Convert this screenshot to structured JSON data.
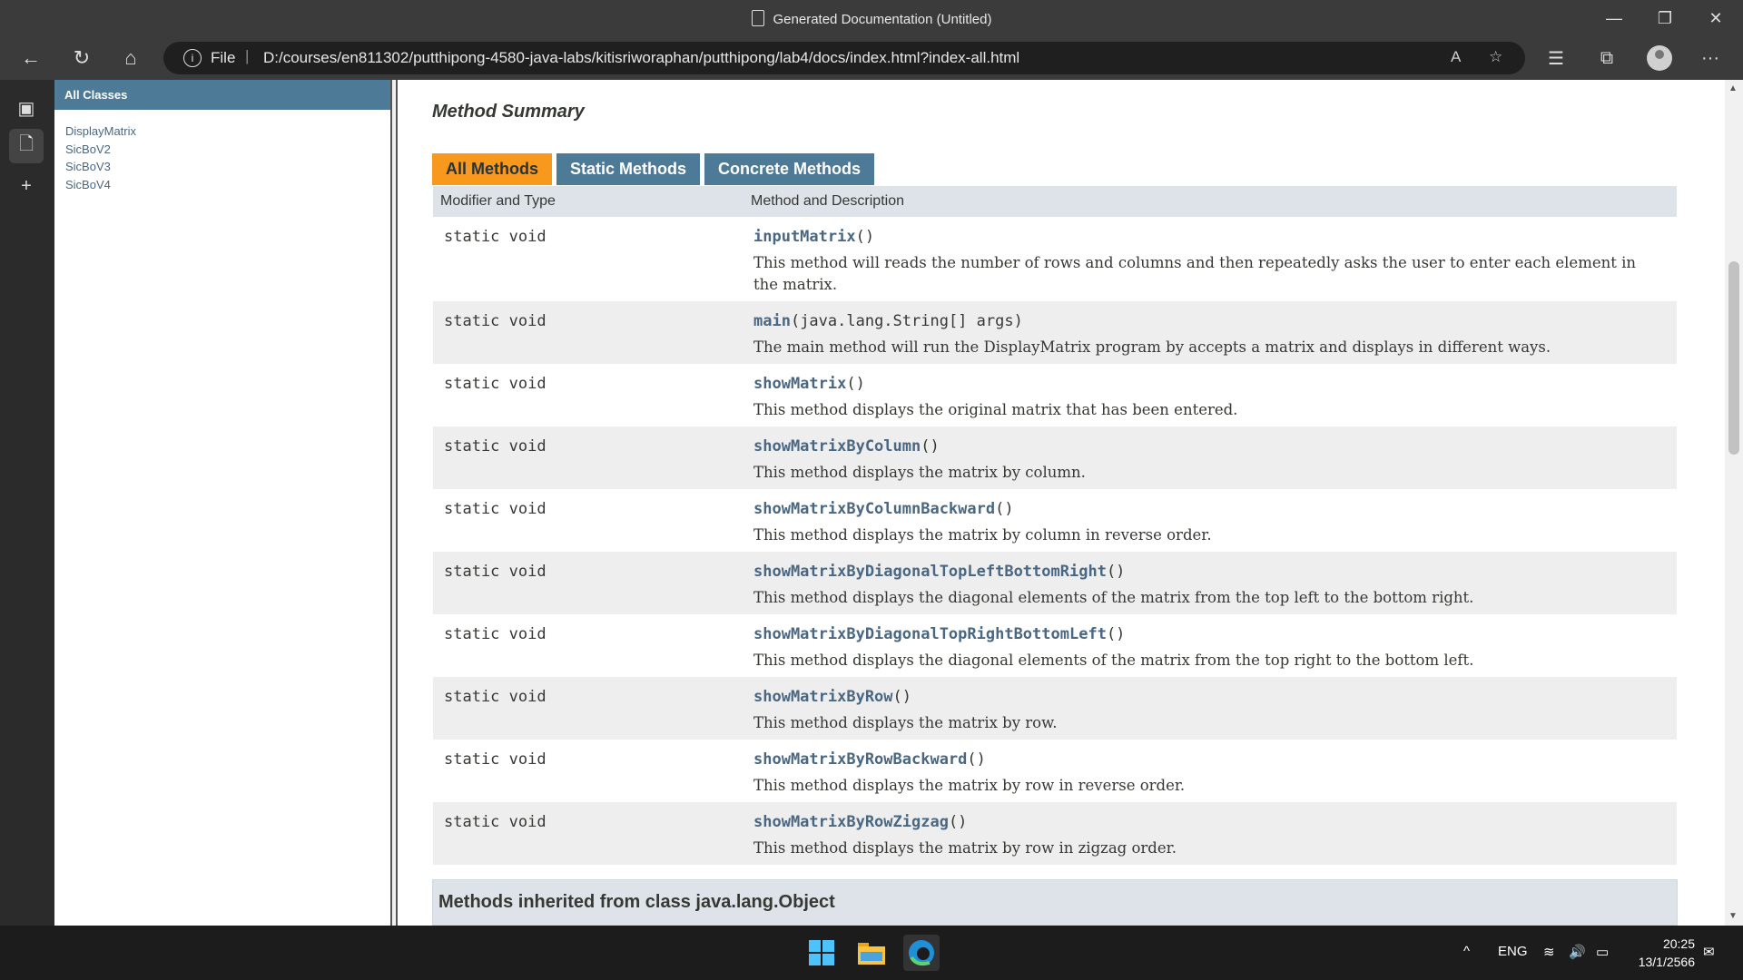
{
  "window": {
    "title": "Generated Documentation (Untitled)",
    "minimize": "—",
    "restore": "❐",
    "close": "✕"
  },
  "browser": {
    "back": "←",
    "refresh": "↻",
    "home": "⌂",
    "address_info": "i",
    "address_scheme": "File",
    "address_sep": "|",
    "url": "D:/courses/en811302/putthipong-4580-java-labs/kitisriworaphan/putthipong/lab4/docs/index.html?index-all.html",
    "read_aloud": "A",
    "add_favorite": "☆",
    "favorites": "☰",
    "collections": "⧉",
    "menu": "···"
  },
  "left_frame": {
    "header": "All Classes",
    "classes": [
      "DisplayMatrix",
      "SicBoV2",
      "SicBoV3",
      "SicBoV4"
    ]
  },
  "main": {
    "section_title": "Method Summary",
    "tabs": [
      "All Methods",
      "Static Methods",
      "Concrete Methods"
    ],
    "columns": [
      "Modifier and Type",
      "Method and Description"
    ],
    "rows": [
      {
        "mod": "static void",
        "name": "inputMatrix",
        "args": "()",
        "desc": "This method will reads the number of rows and columns and then repeatedly asks the user to enter each element in the matrix."
      },
      {
        "mod": "static void",
        "name": "main",
        "args": "(java.lang.String[] args)",
        "desc": "The main method will run the DisplayMatrix program by accepts a matrix and displays in different ways."
      },
      {
        "mod": "static void",
        "name": "showMatrix",
        "args": "()",
        "desc": "This method displays the original matrix that has been entered."
      },
      {
        "mod": "static void",
        "name": "showMatrixByColumn",
        "args": "()",
        "desc": "This method displays the matrix by column."
      },
      {
        "mod": "static void",
        "name": "showMatrixByColumnBackward",
        "args": "()",
        "desc": "This method displays the matrix by column in reverse order."
      },
      {
        "mod": "static void",
        "name": "showMatrixByDiagonalTopLeftBottomRight",
        "args": "()",
        "desc": "This method displays the diagonal elements of the matrix from the top left to the bottom right."
      },
      {
        "mod": "static void",
        "name": "showMatrixByDiagonalTopRightBottomLeft",
        "args": "()",
        "desc": "This method displays the diagonal elements of the matrix from the top right to the bottom left."
      },
      {
        "mod": "static void",
        "name": "showMatrixByRow",
        "args": "()",
        "desc": "This method displays the matrix by row."
      },
      {
        "mod": "static void",
        "name": "showMatrixByRowBackward",
        "args": "()",
        "desc": "This method displays the matrix by row in reverse order."
      },
      {
        "mod": "static void",
        "name": "showMatrixByRowZigzag",
        "args": "()",
        "desc": "This method displays the matrix by row in zigzag order."
      }
    ],
    "inherited": "Methods inherited from class java.lang.Object"
  },
  "taskbar": {
    "language": "ENG",
    "time": "20:25",
    "date": "13/1/2566"
  }
}
